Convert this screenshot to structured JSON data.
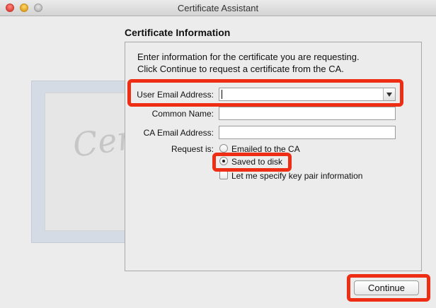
{
  "window": {
    "title": "Certificate Assistant"
  },
  "section": {
    "title": "Certificate Information",
    "intro_line1": "Enter information for the certificate you are requesting.",
    "intro_line2": "Click Continue to request a certificate from the CA."
  },
  "form": {
    "user_email_label": "User Email Address:",
    "user_email_value": "",
    "common_name_label": "Common Name:",
    "common_name_value": "",
    "ca_email_label": "CA Email Address:",
    "ca_email_value": "",
    "request_label": "Request is:",
    "options": [
      {
        "label": "Emailed to the CA",
        "selected": false
      },
      {
        "label": "Saved to disk",
        "selected": true
      }
    ],
    "key_pair_checkbox": {
      "label": "Let me specify key pair information",
      "checked": false
    }
  },
  "background_art": {
    "word": "Certificate"
  },
  "buttons": {
    "continue_label": "Continue"
  },
  "colors": {
    "highlight": "#ee2d15",
    "close": "#e0443e",
    "minimize": "#e0a526",
    "maximize": "#b9b9b9"
  },
  "icons": [
    "close-light-icon",
    "minimize-light-icon",
    "maximize-light-icon",
    "chevron-down-icon",
    "radio-icon",
    "checkbox-icon",
    "certificate-seal-icon"
  ]
}
